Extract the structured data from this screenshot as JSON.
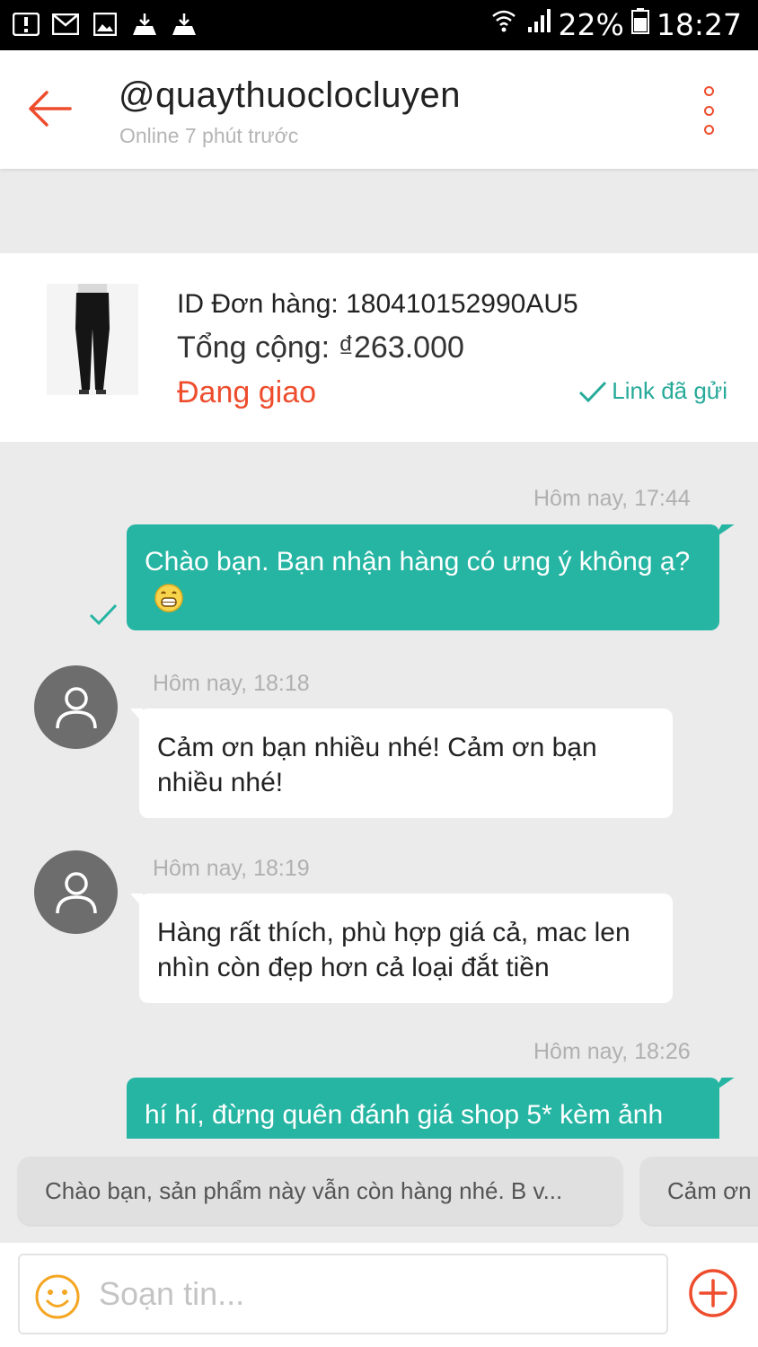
{
  "status_bar": {
    "battery": "22%",
    "time": "18:27",
    "icons": [
      "alert-icon",
      "mail-icon",
      "image-icon",
      "update-icon",
      "update-icon",
      "wifi-icon",
      "signal-icon",
      "battery-icon"
    ]
  },
  "header": {
    "title": "@quaythuoclocluyen",
    "subtitle": "Online 7 phút trước",
    "back_icon": "back-arrow-icon",
    "more_icon": "more-vertical-icon",
    "accent_color": "#ee4d2d"
  },
  "order": {
    "id_text": "ID Đơn hàng: 180410152990AU5",
    "total_text": "Tổng cộng: ₫263.000",
    "status": "Đang giao",
    "link_status": "Link đã gửi",
    "image": "product-thumbnail"
  },
  "messages": [
    {
      "time": "Hôm nay, 17:44",
      "direction": "out",
      "text": "Chào bạn.  Bạn nhận hàng có ưng ý không ạ?",
      "emoji": "grinning-face-icon",
      "read": true
    },
    {
      "time": "Hôm nay, 18:18",
      "direction": "in",
      "text": "Cảm ơn bạn nhiều nhé! Cảm ơn bạn nhiều nhé!"
    },
    {
      "time": "Hôm nay, 18:19",
      "direction": "in",
      "text": "Hàng rất thích, phù hợp giá cả, mac len nhìn còn đẹp hơn cả loại đắt tiền"
    },
    {
      "time": "Hôm nay, 18:26",
      "direction": "out",
      "text": "hí hí, đừng quên đánh giá shop 5* kèm ảnh"
    }
  ],
  "quick_replies": [
    "Chào bạn, sản phẩm này vẫn còn hàng nhé. B v...",
    "Cảm ơn"
  ],
  "composer": {
    "placeholder": "Soạn tin...",
    "emoji_icon": "smiley-icon",
    "add_icon": "plus-circle-icon"
  },
  "colors": {
    "out_bubble": "#26b5a3",
    "accent": "#ee4d2d",
    "check": "#26aa99"
  }
}
